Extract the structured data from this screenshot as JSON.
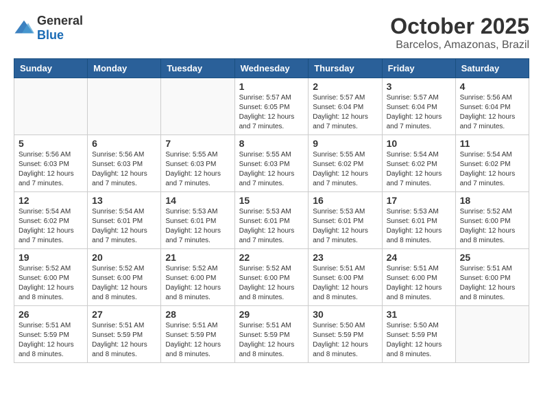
{
  "logo": {
    "general": "General",
    "blue": "Blue"
  },
  "header": {
    "title": "October 2025",
    "subtitle": "Barcelos, Amazonas, Brazil"
  },
  "days_of_week": [
    "Sunday",
    "Monday",
    "Tuesday",
    "Wednesday",
    "Thursday",
    "Friday",
    "Saturday"
  ],
  "weeks": [
    [
      {
        "day": "",
        "info": ""
      },
      {
        "day": "",
        "info": ""
      },
      {
        "day": "",
        "info": ""
      },
      {
        "day": "1",
        "info": "Sunrise: 5:57 AM\nSunset: 6:05 PM\nDaylight: 12 hours and 7 minutes."
      },
      {
        "day": "2",
        "info": "Sunrise: 5:57 AM\nSunset: 6:04 PM\nDaylight: 12 hours and 7 minutes."
      },
      {
        "day": "3",
        "info": "Sunrise: 5:57 AM\nSunset: 6:04 PM\nDaylight: 12 hours and 7 minutes."
      },
      {
        "day": "4",
        "info": "Sunrise: 5:56 AM\nSunset: 6:04 PM\nDaylight: 12 hours and 7 minutes."
      }
    ],
    [
      {
        "day": "5",
        "info": "Sunrise: 5:56 AM\nSunset: 6:03 PM\nDaylight: 12 hours and 7 minutes."
      },
      {
        "day": "6",
        "info": "Sunrise: 5:56 AM\nSunset: 6:03 PM\nDaylight: 12 hours and 7 minutes."
      },
      {
        "day": "7",
        "info": "Sunrise: 5:55 AM\nSunset: 6:03 PM\nDaylight: 12 hours and 7 minutes."
      },
      {
        "day": "8",
        "info": "Sunrise: 5:55 AM\nSunset: 6:03 PM\nDaylight: 12 hours and 7 minutes."
      },
      {
        "day": "9",
        "info": "Sunrise: 5:55 AM\nSunset: 6:02 PM\nDaylight: 12 hours and 7 minutes."
      },
      {
        "day": "10",
        "info": "Sunrise: 5:54 AM\nSunset: 6:02 PM\nDaylight: 12 hours and 7 minutes."
      },
      {
        "day": "11",
        "info": "Sunrise: 5:54 AM\nSunset: 6:02 PM\nDaylight: 12 hours and 7 minutes."
      }
    ],
    [
      {
        "day": "12",
        "info": "Sunrise: 5:54 AM\nSunset: 6:02 PM\nDaylight: 12 hours and 7 minutes."
      },
      {
        "day": "13",
        "info": "Sunrise: 5:54 AM\nSunset: 6:01 PM\nDaylight: 12 hours and 7 minutes."
      },
      {
        "day": "14",
        "info": "Sunrise: 5:53 AM\nSunset: 6:01 PM\nDaylight: 12 hours and 7 minutes."
      },
      {
        "day": "15",
        "info": "Sunrise: 5:53 AM\nSunset: 6:01 PM\nDaylight: 12 hours and 7 minutes."
      },
      {
        "day": "16",
        "info": "Sunrise: 5:53 AM\nSunset: 6:01 PM\nDaylight: 12 hours and 7 minutes."
      },
      {
        "day": "17",
        "info": "Sunrise: 5:53 AM\nSunset: 6:01 PM\nDaylight: 12 hours and 8 minutes."
      },
      {
        "day": "18",
        "info": "Sunrise: 5:52 AM\nSunset: 6:00 PM\nDaylight: 12 hours and 8 minutes."
      }
    ],
    [
      {
        "day": "19",
        "info": "Sunrise: 5:52 AM\nSunset: 6:00 PM\nDaylight: 12 hours and 8 minutes."
      },
      {
        "day": "20",
        "info": "Sunrise: 5:52 AM\nSunset: 6:00 PM\nDaylight: 12 hours and 8 minutes."
      },
      {
        "day": "21",
        "info": "Sunrise: 5:52 AM\nSunset: 6:00 PM\nDaylight: 12 hours and 8 minutes."
      },
      {
        "day": "22",
        "info": "Sunrise: 5:52 AM\nSunset: 6:00 PM\nDaylight: 12 hours and 8 minutes."
      },
      {
        "day": "23",
        "info": "Sunrise: 5:51 AM\nSunset: 6:00 PM\nDaylight: 12 hours and 8 minutes."
      },
      {
        "day": "24",
        "info": "Sunrise: 5:51 AM\nSunset: 6:00 PM\nDaylight: 12 hours and 8 minutes."
      },
      {
        "day": "25",
        "info": "Sunrise: 5:51 AM\nSunset: 6:00 PM\nDaylight: 12 hours and 8 minutes."
      }
    ],
    [
      {
        "day": "26",
        "info": "Sunrise: 5:51 AM\nSunset: 5:59 PM\nDaylight: 12 hours and 8 minutes."
      },
      {
        "day": "27",
        "info": "Sunrise: 5:51 AM\nSunset: 5:59 PM\nDaylight: 12 hours and 8 minutes."
      },
      {
        "day": "28",
        "info": "Sunrise: 5:51 AM\nSunset: 5:59 PM\nDaylight: 12 hours and 8 minutes."
      },
      {
        "day": "29",
        "info": "Sunrise: 5:51 AM\nSunset: 5:59 PM\nDaylight: 12 hours and 8 minutes."
      },
      {
        "day": "30",
        "info": "Sunrise: 5:50 AM\nSunset: 5:59 PM\nDaylight: 12 hours and 8 minutes."
      },
      {
        "day": "31",
        "info": "Sunrise: 5:50 AM\nSunset: 5:59 PM\nDaylight: 12 hours and 8 minutes."
      },
      {
        "day": "",
        "info": ""
      }
    ]
  ]
}
